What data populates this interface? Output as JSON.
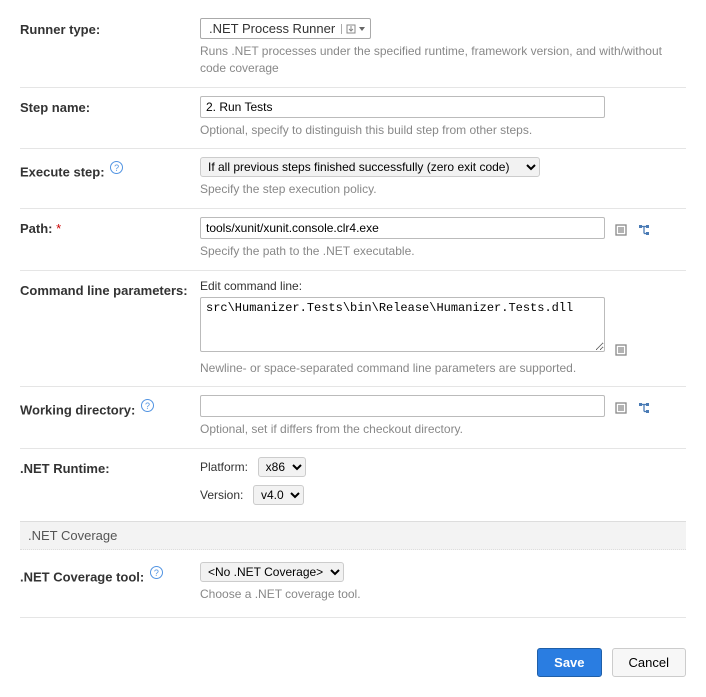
{
  "runner_type": {
    "label": "Runner type:",
    "value": ".NET Process Runner",
    "help": "Runs .NET processes under the specified runtime, framework version, and with/without code coverage"
  },
  "step_name": {
    "label": "Step name:",
    "value": "2. Run Tests",
    "help": "Optional, specify to distinguish this build step from other steps."
  },
  "execute_step": {
    "label": "Execute step:",
    "value": "If all previous steps finished successfully (zero exit code)",
    "help": "Specify the step execution policy."
  },
  "path": {
    "label": "Path:",
    "value": "tools/xunit/xunit.console.clr4.exe",
    "help": "Specify the path to the .NET executable."
  },
  "cmd_params": {
    "label": "Command line parameters:",
    "sublabel": "Edit command line:",
    "value": "src\\Humanizer.Tests\\bin\\Release\\Humanizer.Tests.dll",
    "help": "Newline- or space-separated command line parameters are supported."
  },
  "working_dir": {
    "label": "Working directory:",
    "value": "",
    "help": "Optional, set if differs from the checkout directory."
  },
  "net_runtime": {
    "label": ".NET Runtime:",
    "platform_label": "Platform:",
    "platform_value": "x86",
    "version_label": "Version:",
    "version_value": "v4.0"
  },
  "net_coverage_section": ".NET Coverage",
  "net_coverage_tool": {
    "label": ".NET Coverage tool:",
    "value": "<No .NET Coverage>",
    "help": "Choose a .NET coverage tool."
  },
  "buttons": {
    "save": "Save",
    "cancel": "Cancel"
  }
}
